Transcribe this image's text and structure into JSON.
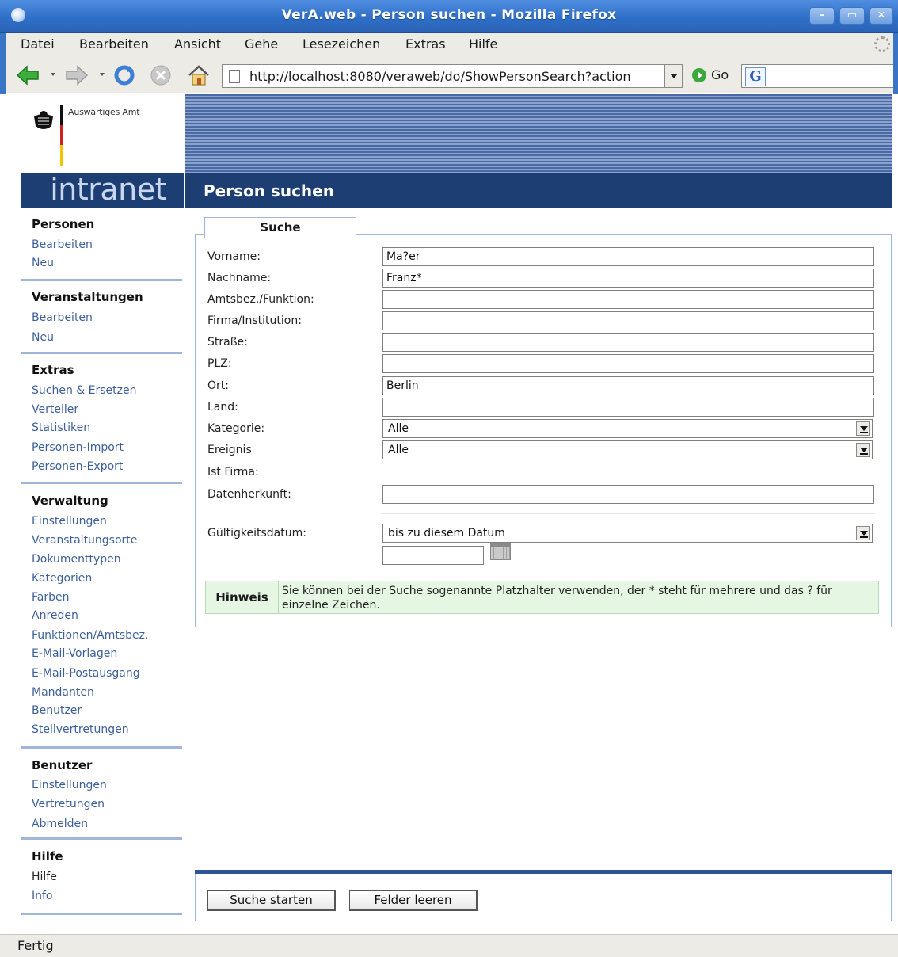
{
  "window": {
    "title": "VerA.web - Person suchen - Mozilla Firefox"
  },
  "menu": [
    "Datei",
    "Bearbeiten",
    "Ansicht",
    "Gehe",
    "Lesezeichen",
    "Extras",
    "Hilfe"
  ],
  "nav": {
    "url": "http://localhost:8080/veraweb/do/ShowPersonSearch?action",
    "go_label": "Go"
  },
  "header": {
    "org_name": "Auswärtiges Amt",
    "brand": "intranet",
    "page_title": "Person suchen"
  },
  "sidebar": {
    "personen": {
      "title": "Personen",
      "items": [
        "Bearbeiten",
        "Neu"
      ]
    },
    "veranstaltungen": {
      "title": "Veranstaltungen",
      "items": [
        "Bearbeiten",
        "Neu"
      ]
    },
    "extras": {
      "title": "Extras",
      "items": [
        "Suchen & Ersetzen",
        "Verteiler",
        "Statistiken",
        "Personen-Import",
        "Personen-Export"
      ]
    },
    "verwaltung": {
      "title": "Verwaltung",
      "items": [
        "Einstellungen",
        "Veranstaltungsorte",
        "Dokumenttypen",
        "Kategorien",
        "Farben",
        "Anreden",
        "Funktionen/Amtsbez.",
        "E-Mail-Vorlagen",
        "E-Mail-Postausgang",
        "Mandanten",
        "Benutzer",
        "Stellvertretungen"
      ]
    },
    "benutzer": {
      "title": "Benutzer",
      "items": [
        "Einstellungen",
        "Vertretungen",
        "Abmelden"
      ]
    },
    "hilfe": {
      "title": "Hilfe",
      "items": [
        "Hilfe",
        "Info"
      ]
    }
  },
  "form": {
    "tab": "Suche",
    "labels": {
      "vorname": "Vorname:",
      "nachname": "Nachname:",
      "amtsbez": "Amtsbez./Funktion:",
      "firma": "Firma/Institution:",
      "strasse": "Straße:",
      "plz": "PLZ:",
      "ort": "Ort:",
      "land": "Land:",
      "kategorie": "Kategorie:",
      "ereignis": "Ereignis",
      "ist_firma": "Ist Firma:",
      "datenherkunft": "Datenherkunft:",
      "gueltigkeit": "Gültigkeitsdatum:"
    },
    "values": {
      "vorname": "Ma?er",
      "nachname": "Franz*",
      "amtsbez": "",
      "firma": "",
      "strasse": "",
      "plz": "",
      "ort": "Berlin",
      "land": "",
      "kategorie": "Alle",
      "ereignis": "Alle",
      "datenherkunft": "",
      "gueltigkeit": "bis zu diesem Datum",
      "datum": ""
    },
    "ist_firma_checked": false,
    "hint_label": "Hinweis",
    "hint_text": "Sie können bei der Suche sogenannte Platzhalter verwenden, der * steht für mehrere und das ? für einzelne Zeichen."
  },
  "buttons": {
    "search": "Suche starten",
    "clear": "Felder leeren"
  },
  "status": "Fertig",
  "colors": {
    "dark_blue": "#1c3e72",
    "link": "#3c5f9a",
    "hint_bg": "#e5f6e3",
    "separator": "#9fb6d8"
  }
}
